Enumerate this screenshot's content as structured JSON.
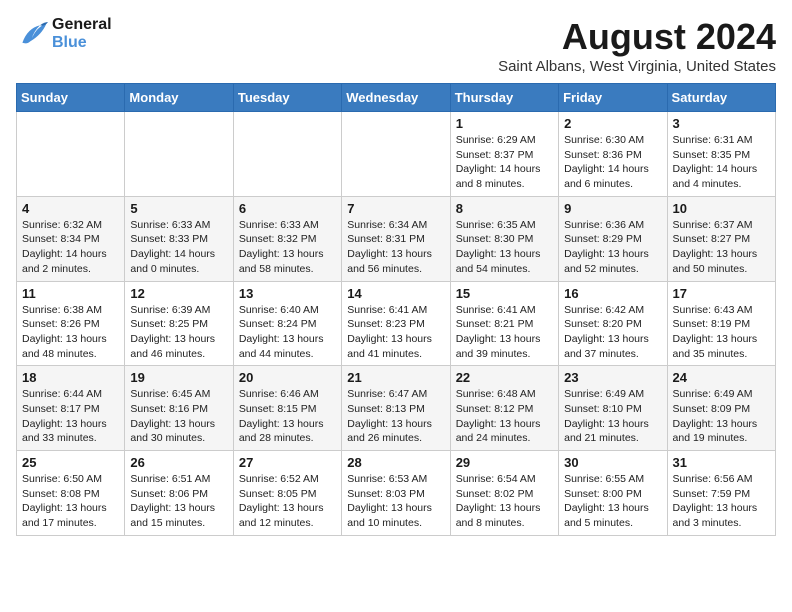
{
  "header": {
    "logo_line1": "General",
    "logo_line2": "Blue",
    "month_year": "August 2024",
    "location": "Saint Albans, West Virginia, United States"
  },
  "days_of_week": [
    "Sunday",
    "Monday",
    "Tuesday",
    "Wednesday",
    "Thursday",
    "Friday",
    "Saturday"
  ],
  "weeks": [
    [
      {
        "day": "",
        "info": ""
      },
      {
        "day": "",
        "info": ""
      },
      {
        "day": "",
        "info": ""
      },
      {
        "day": "",
        "info": ""
      },
      {
        "day": "1",
        "info": "Sunrise: 6:29 AM\nSunset: 8:37 PM\nDaylight: 14 hours\nand 8 minutes."
      },
      {
        "day": "2",
        "info": "Sunrise: 6:30 AM\nSunset: 8:36 PM\nDaylight: 14 hours\nand 6 minutes."
      },
      {
        "day": "3",
        "info": "Sunrise: 6:31 AM\nSunset: 8:35 PM\nDaylight: 14 hours\nand 4 minutes."
      }
    ],
    [
      {
        "day": "4",
        "info": "Sunrise: 6:32 AM\nSunset: 8:34 PM\nDaylight: 14 hours\nand 2 minutes."
      },
      {
        "day": "5",
        "info": "Sunrise: 6:33 AM\nSunset: 8:33 PM\nDaylight: 14 hours\nand 0 minutes."
      },
      {
        "day": "6",
        "info": "Sunrise: 6:33 AM\nSunset: 8:32 PM\nDaylight: 13 hours\nand 58 minutes."
      },
      {
        "day": "7",
        "info": "Sunrise: 6:34 AM\nSunset: 8:31 PM\nDaylight: 13 hours\nand 56 minutes."
      },
      {
        "day": "8",
        "info": "Sunrise: 6:35 AM\nSunset: 8:30 PM\nDaylight: 13 hours\nand 54 minutes."
      },
      {
        "day": "9",
        "info": "Sunrise: 6:36 AM\nSunset: 8:29 PM\nDaylight: 13 hours\nand 52 minutes."
      },
      {
        "day": "10",
        "info": "Sunrise: 6:37 AM\nSunset: 8:27 PM\nDaylight: 13 hours\nand 50 minutes."
      }
    ],
    [
      {
        "day": "11",
        "info": "Sunrise: 6:38 AM\nSunset: 8:26 PM\nDaylight: 13 hours\nand 48 minutes."
      },
      {
        "day": "12",
        "info": "Sunrise: 6:39 AM\nSunset: 8:25 PM\nDaylight: 13 hours\nand 46 minutes."
      },
      {
        "day": "13",
        "info": "Sunrise: 6:40 AM\nSunset: 8:24 PM\nDaylight: 13 hours\nand 44 minutes."
      },
      {
        "day": "14",
        "info": "Sunrise: 6:41 AM\nSunset: 8:23 PM\nDaylight: 13 hours\nand 41 minutes."
      },
      {
        "day": "15",
        "info": "Sunrise: 6:41 AM\nSunset: 8:21 PM\nDaylight: 13 hours\nand 39 minutes."
      },
      {
        "day": "16",
        "info": "Sunrise: 6:42 AM\nSunset: 8:20 PM\nDaylight: 13 hours\nand 37 minutes."
      },
      {
        "day": "17",
        "info": "Sunrise: 6:43 AM\nSunset: 8:19 PM\nDaylight: 13 hours\nand 35 minutes."
      }
    ],
    [
      {
        "day": "18",
        "info": "Sunrise: 6:44 AM\nSunset: 8:17 PM\nDaylight: 13 hours\nand 33 minutes."
      },
      {
        "day": "19",
        "info": "Sunrise: 6:45 AM\nSunset: 8:16 PM\nDaylight: 13 hours\nand 30 minutes."
      },
      {
        "day": "20",
        "info": "Sunrise: 6:46 AM\nSunset: 8:15 PM\nDaylight: 13 hours\nand 28 minutes."
      },
      {
        "day": "21",
        "info": "Sunrise: 6:47 AM\nSunset: 8:13 PM\nDaylight: 13 hours\nand 26 minutes."
      },
      {
        "day": "22",
        "info": "Sunrise: 6:48 AM\nSunset: 8:12 PM\nDaylight: 13 hours\nand 24 minutes."
      },
      {
        "day": "23",
        "info": "Sunrise: 6:49 AM\nSunset: 8:10 PM\nDaylight: 13 hours\nand 21 minutes."
      },
      {
        "day": "24",
        "info": "Sunrise: 6:49 AM\nSunset: 8:09 PM\nDaylight: 13 hours\nand 19 minutes."
      }
    ],
    [
      {
        "day": "25",
        "info": "Sunrise: 6:50 AM\nSunset: 8:08 PM\nDaylight: 13 hours\nand 17 minutes."
      },
      {
        "day": "26",
        "info": "Sunrise: 6:51 AM\nSunset: 8:06 PM\nDaylight: 13 hours\nand 15 minutes."
      },
      {
        "day": "27",
        "info": "Sunrise: 6:52 AM\nSunset: 8:05 PM\nDaylight: 13 hours\nand 12 minutes."
      },
      {
        "day": "28",
        "info": "Sunrise: 6:53 AM\nSunset: 8:03 PM\nDaylight: 13 hours\nand 10 minutes."
      },
      {
        "day": "29",
        "info": "Sunrise: 6:54 AM\nSunset: 8:02 PM\nDaylight: 13 hours\nand 8 minutes."
      },
      {
        "day": "30",
        "info": "Sunrise: 6:55 AM\nSunset: 8:00 PM\nDaylight: 13 hours\nand 5 minutes."
      },
      {
        "day": "31",
        "info": "Sunrise: 6:56 AM\nSunset: 7:59 PM\nDaylight: 13 hours\nand 3 minutes."
      }
    ]
  ]
}
